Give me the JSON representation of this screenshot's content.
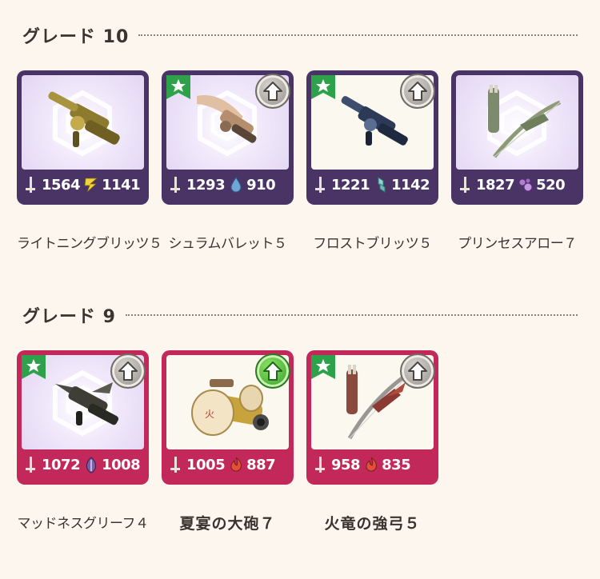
{
  "sections": [
    {
      "title": "グレード 10",
      "items": [
        {
          "name": "ライトニングブリッツ５",
          "attack": "1564",
          "element_value": "1141",
          "element_icon": "thunder-icon",
          "theme": "purple",
          "art_bg": "lavender",
          "weapon_icon": "bowgun-gold-icon",
          "starred": false,
          "upgrade": "none"
        },
        {
          "name": "シュラムバレット５",
          "attack": "1293",
          "element_value": "910",
          "element_icon": "water-icon",
          "theme": "purple",
          "art_bg": "lavender",
          "weapon_icon": "bowgun-bone-icon",
          "starred": true,
          "upgrade": "gray"
        },
        {
          "name": "フロストブリッツ５",
          "attack": "1221",
          "element_value": "1142",
          "element_icon": "ice-icon",
          "theme": "purple",
          "art_bg": "cream",
          "weapon_icon": "bowgun-navy-icon",
          "starred": true,
          "upgrade": "gray"
        },
        {
          "name": "プリンセスアロー７",
          "attack": "1827",
          "element_value": "520",
          "element_icon": "poison-icon",
          "theme": "purple",
          "art_bg": "lavender",
          "weapon_icon": "bow-green-icon",
          "starred": false,
          "upgrade": "none"
        }
      ]
    },
    {
      "title": "グレード 9",
      "items": [
        {
          "name": "マッドネスグリーフ４",
          "attack": "1072",
          "element_value": "1008",
          "element_icon": "dragon-icon",
          "theme": "crimson",
          "art_bg": "lavender",
          "weapon_icon": "bowgun-dark-icon",
          "starred": true,
          "upgrade": "gray"
        },
        {
          "name": "夏宴の大砲７",
          "attack": "1005",
          "element_value": "887",
          "element_icon": "fire-icon",
          "theme": "crimson",
          "art_bg": "cream",
          "weapon_icon": "cannon-festival-icon",
          "starred": false,
          "upgrade": "green"
        },
        {
          "name": "火竜の強弓５",
          "attack": "958",
          "element_value": "835",
          "element_icon": "fire-icon",
          "theme": "crimson",
          "art_bg": "cream",
          "weapon_icon": "bow-rathalos-icon",
          "starred": true,
          "upgrade": "gray"
        }
      ]
    }
  ],
  "colors": {
    "background": "#fcf6ef",
    "purple_frame": "#4a3466",
    "crimson_frame": "#c2295a",
    "ribbon_green": "#2da24a",
    "upgrade_green": "#2f9a22"
  }
}
